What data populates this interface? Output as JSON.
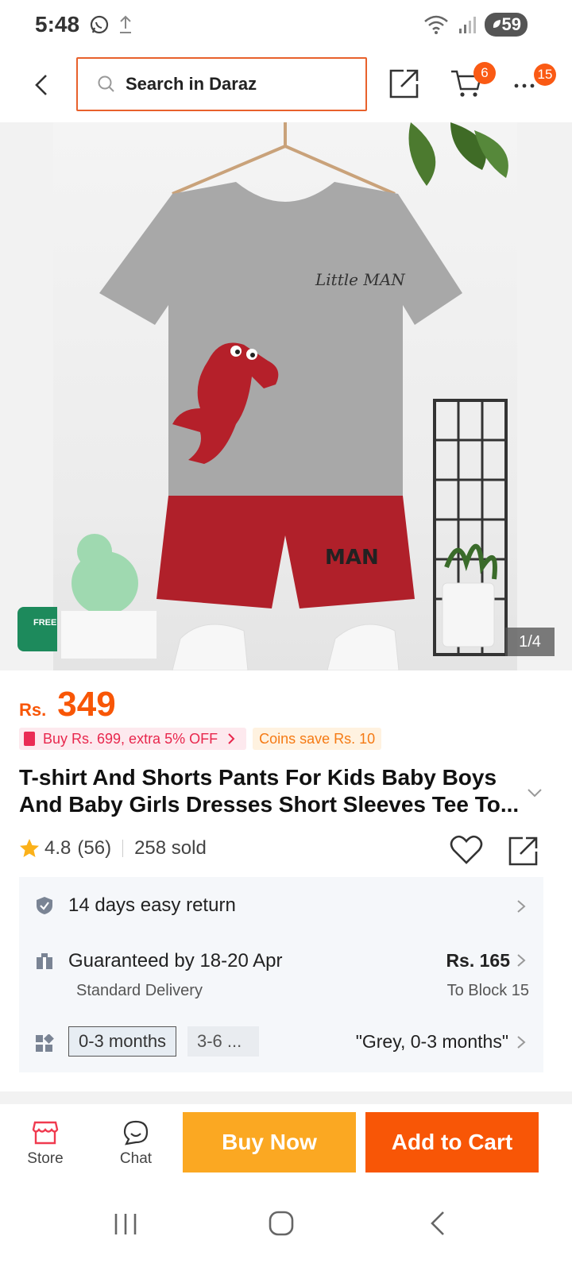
{
  "status_bar": {
    "time": "5:48",
    "battery": "59",
    "icons": [
      "whatsapp-icon",
      "upload-icon",
      "wifi-icon",
      "signal-icon",
      "battery-icon"
    ]
  },
  "header": {
    "search_placeholder": "Search in Daraz",
    "cart_count": "6",
    "more_count": "15"
  },
  "gallery": {
    "image_alt": "Grey Little MAN dinosaur t-shirt with red shorts",
    "shirt_print": "Little MAN",
    "free_badge": "FREE",
    "counter": "1/4"
  },
  "product": {
    "currency": "Rs.",
    "price": "349",
    "promo_voucher": "Buy Rs. 699, extra 5% OFF",
    "promo_coins": "Coins save Rs. 10",
    "title": "T-shirt And Shorts Pants For Kids Baby Boys And Baby Girls Dresses Short Sleeves Tee To...",
    "rating": "4.8",
    "rating_count": "(56)",
    "sold": "258 sold"
  },
  "info": {
    "return_text": "14 days easy return",
    "delivery_text": "Guaranteed by 18-20 Apr",
    "delivery_type": "Standard Delivery",
    "delivery_price": "Rs. 165",
    "delivery_to": "To Block 15",
    "variant_options": [
      "0-3 months",
      "3-6 ..."
    ],
    "variant_selected": "\"Grey, 0-3 months\""
  },
  "actions": {
    "store_label": "Store",
    "chat_label": "Chat",
    "buy_now_label": "Buy Now",
    "add_to_cart_label": "Add to Cart"
  },
  "colors": {
    "accent_orange": "#f85606",
    "buy_now": "#fba822",
    "promo_pink": "#e8274d",
    "free_green": "#1d8a5c"
  }
}
